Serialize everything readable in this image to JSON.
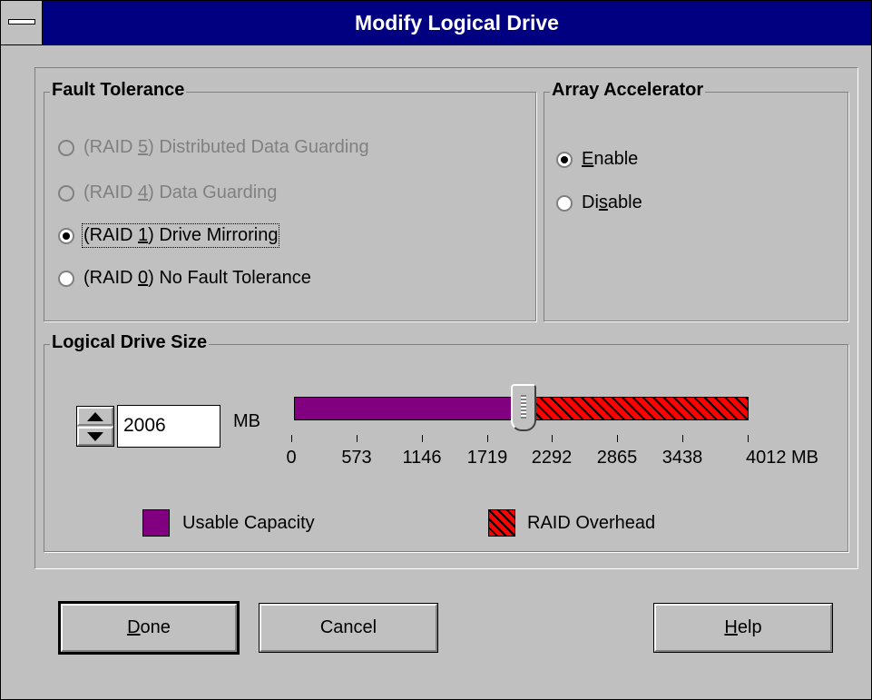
{
  "window": {
    "title": "Modify Logical Drive"
  },
  "fault_tolerance": {
    "label": "Fault Tolerance",
    "options": [
      {
        "pre": "(RAID ",
        "key": "5",
        "post": ") Distributed Data Guarding",
        "enabled": false,
        "selected": false
      },
      {
        "pre": "(RAID ",
        "key": "4",
        "post": ") Data Guarding",
        "enabled": false,
        "selected": false
      },
      {
        "pre": "(RAID ",
        "key": "1",
        "post": ") Drive Mirroring",
        "enabled": true,
        "selected": true
      },
      {
        "pre": "(RAID ",
        "key": "0",
        "post": ") No Fault Tolerance",
        "enabled": true,
        "selected": false
      }
    ]
  },
  "array_accelerator": {
    "label": "Array Accelerator",
    "options": [
      {
        "pre": "",
        "key": "E",
        "post": "nable",
        "selected": true
      },
      {
        "pre": "Di",
        "key": "s",
        "post": "able",
        "selected": false
      }
    ]
  },
  "logical_drive_size": {
    "label": "Logical Drive Size",
    "value": "2006",
    "unit": "MB",
    "scale_max": 4012,
    "usable_value": 2006,
    "ticks": [
      "0",
      "573",
      "1146",
      "1719",
      "2292",
      "2865",
      "3438",
      "4012 MB"
    ],
    "legend": {
      "usable": "Usable Capacity",
      "overhead": "RAID Overhead"
    },
    "colors": {
      "usable": "#800080",
      "overhead": "#ff0000"
    }
  },
  "buttons": {
    "done": {
      "key": "D",
      "rest": "one"
    },
    "cancel": {
      "label": "Cancel"
    },
    "help": {
      "key": "H",
      "rest": "elp"
    }
  }
}
